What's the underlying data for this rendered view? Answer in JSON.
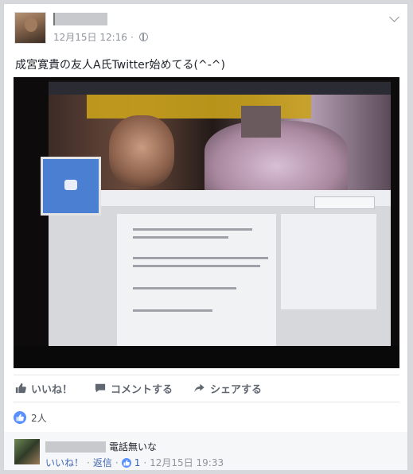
{
  "post": {
    "timestamp": "12月15日 12:16",
    "visibility_separator": "·",
    "text": "成宮寛貴の友人A氏Twitter始めてる(^-^)"
  },
  "actions": {
    "like": "いいね！",
    "comment": "コメントする",
    "share": "シェアする"
  },
  "reactions": {
    "count": "2人"
  },
  "comment": {
    "text": "電話無いな",
    "like_link": "いいね！",
    "separator1": "·",
    "reply_link": "返信",
    "separator2": "·",
    "like_count": "1",
    "separator3": "·",
    "timestamp": "12月15日 19:33"
  },
  "colors": {
    "accent": "#4267b2",
    "like_blue": "#5890ff",
    "muted": "#90949c"
  }
}
